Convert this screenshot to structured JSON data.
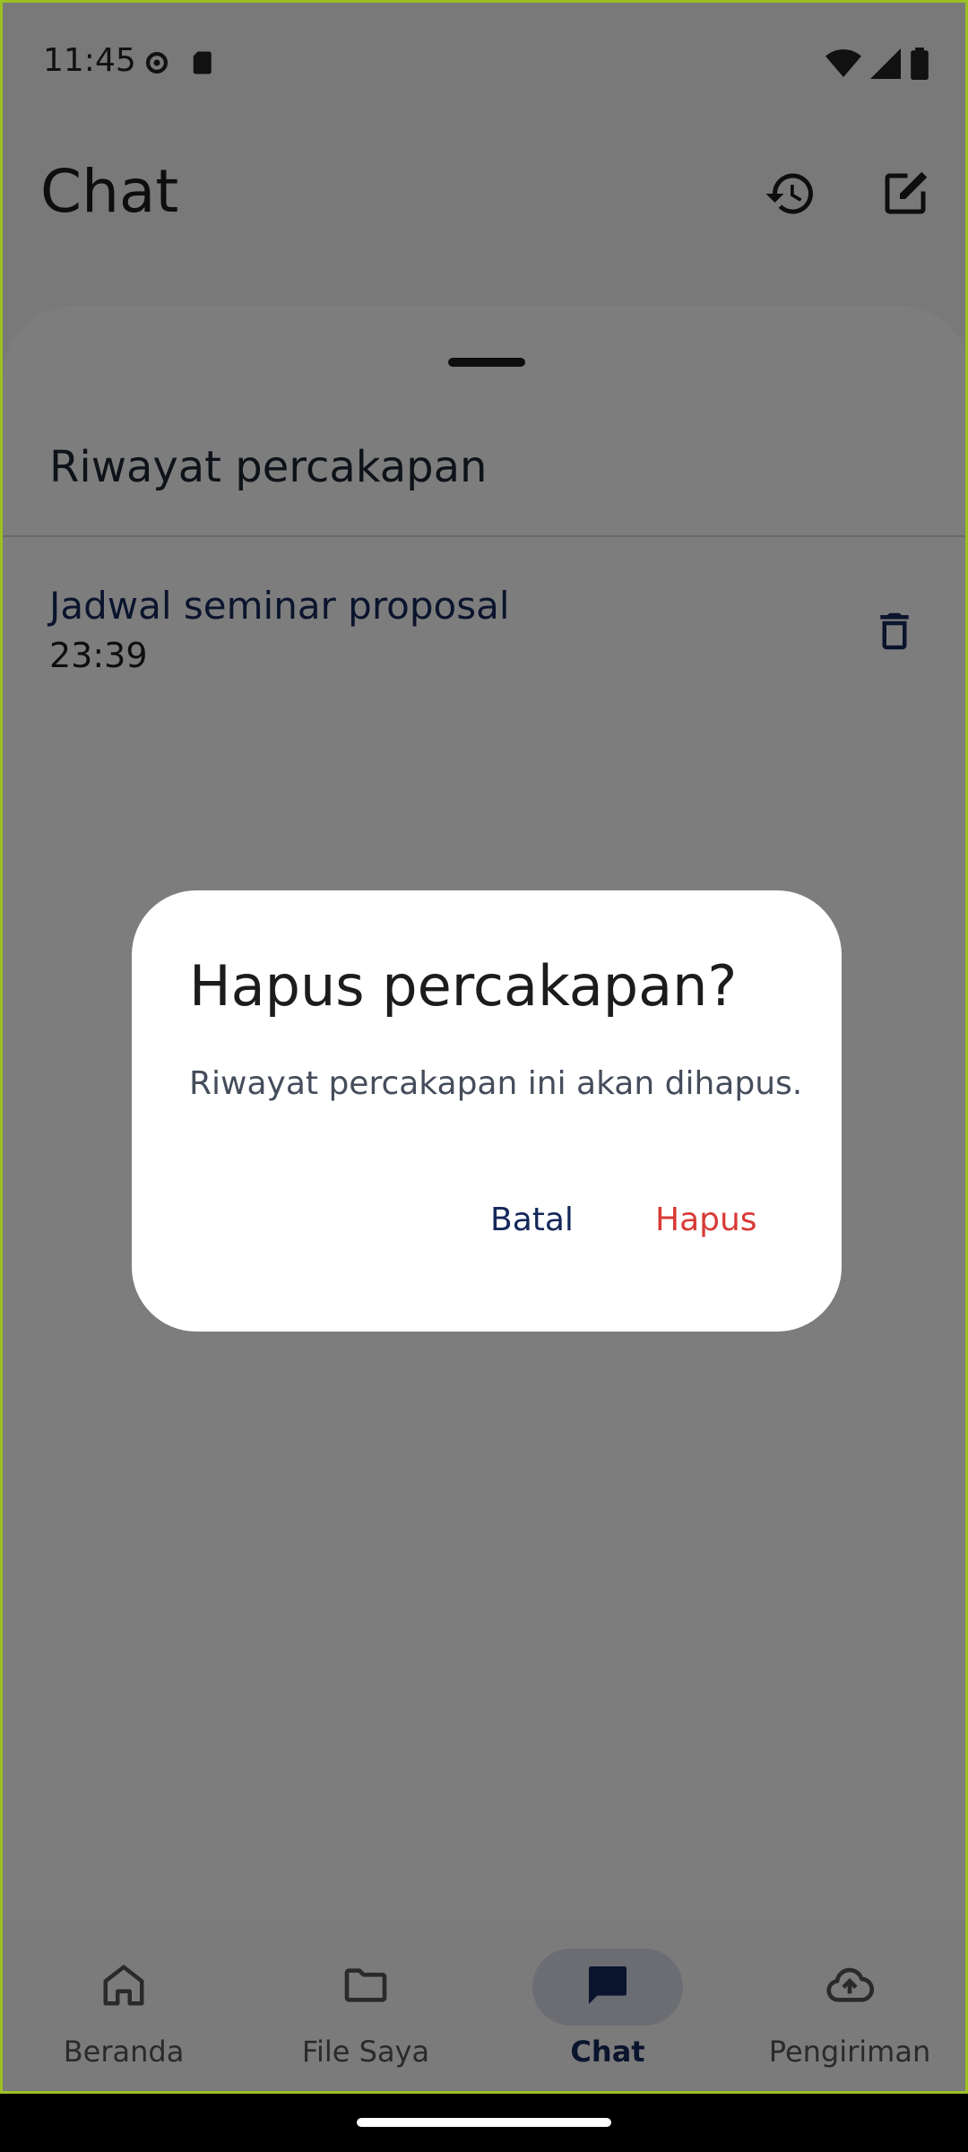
{
  "status_bar": {
    "time": "11:45",
    "icons": [
      "settings-icon",
      "sd-card-icon",
      "wifi-icon",
      "signal-icon",
      "battery-icon"
    ]
  },
  "app_bar": {
    "title": "Chat",
    "actions": [
      "history-icon",
      "edit-icon"
    ]
  },
  "sheet": {
    "title": "Riwayat percakapan",
    "conversations": [
      {
        "title": "Jadwal seminar proposal",
        "time": "23:39"
      }
    ]
  },
  "dialog": {
    "title": "Hapus percakapan?",
    "message": "Riwayat percakapan ini akan dihapus.",
    "cancel_label": "Batal",
    "confirm_label": "Hapus"
  },
  "bottom_nav": {
    "items": [
      {
        "label": "Beranda",
        "icon": "home-icon"
      },
      {
        "label": "File Saya",
        "icon": "folder-icon"
      },
      {
        "label": "Chat",
        "icon": "chat-icon",
        "active": true
      },
      {
        "label": "Pengiriman",
        "icon": "cloud-upload-icon"
      }
    ]
  },
  "colors": {
    "accent": "#14285a",
    "danger": "#d93a36",
    "active_pill": "#d6dbe6"
  }
}
